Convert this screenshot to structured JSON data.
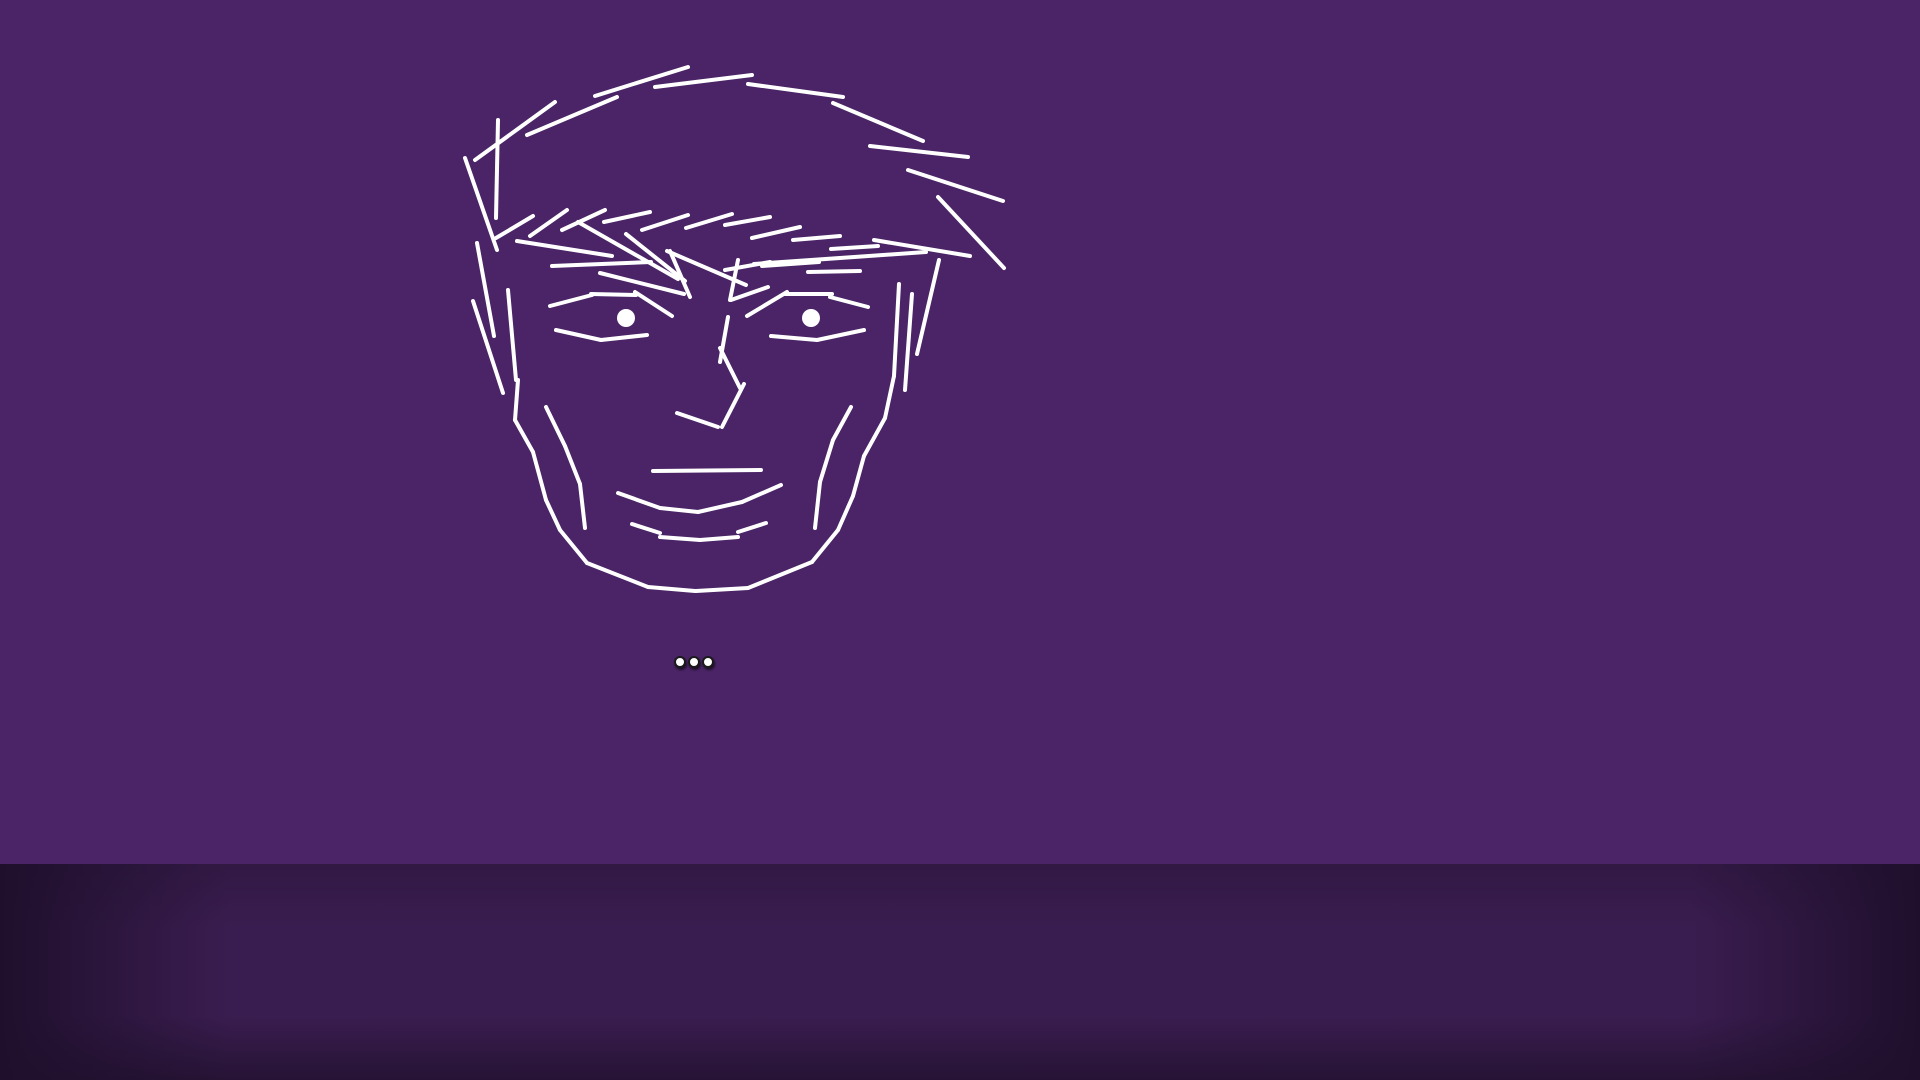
{
  "scene": {
    "background_color": "#4a2466",
    "floor_color": "#3a1d50",
    "floor_edge_color": "#1f0f2c",
    "line_color": "#ffffff"
  },
  "face_drawing": {
    "subject": "line-sketch-face",
    "eye_icon": "eye-dot"
  },
  "loading_indicator": {
    "icon": "three-dots-icon",
    "dot_count": 3,
    "dot_fill": "#ffffff",
    "dot_border": "#1a1a1a"
  }
}
